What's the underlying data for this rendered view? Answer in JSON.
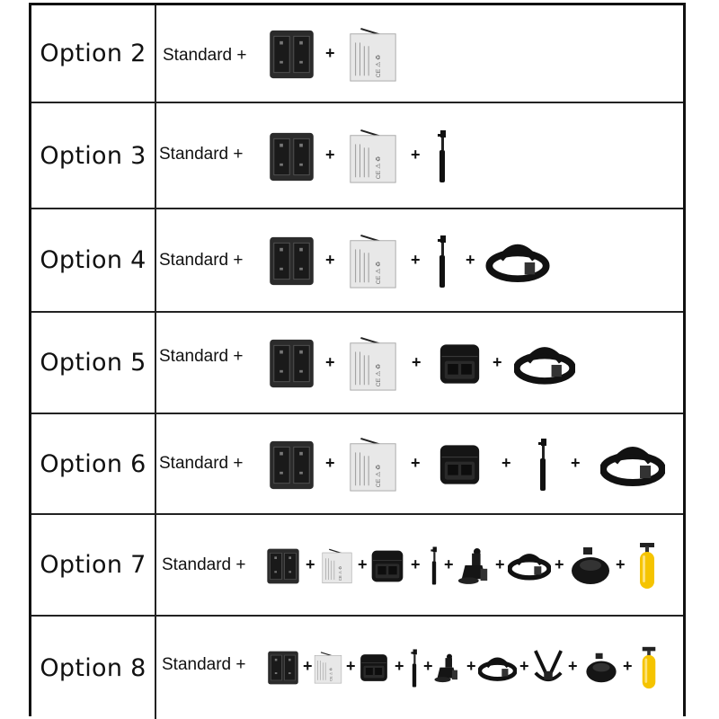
{
  "separator": "+",
  "rows": [
    {
      "label": "Option 2",
      "standard": "Standard +",
      "items": [
        "charger-icon",
        "battery-icon"
      ]
    },
    {
      "label": "Option 3",
      "standard": "Standard +",
      "items": [
        "charger-icon",
        "battery-icon",
        "monopod-icon"
      ]
    },
    {
      "label": "Option 4",
      "standard": "Standard +",
      "items": [
        "charger-icon",
        "battery-icon",
        "monopod-icon",
        "head-strap-icon"
      ]
    },
    {
      "label": "Option 5",
      "standard": "Standard +",
      "items": [
        "charger-icon",
        "battery-icon",
        "carry-case-icon",
        "head-strap-icon"
      ]
    },
    {
      "label": "Option 6",
      "standard": "Standard +",
      "items": [
        "charger-icon",
        "battery-icon",
        "carry-case-icon",
        "monopod-icon",
        "head-strap-icon"
      ]
    },
    {
      "label": "Option 7",
      "standard": "Standard +",
      "items": [
        "charger-icon",
        "battery-icon",
        "carry-case-icon",
        "monopod-icon",
        "suction-mount-icon",
        "head-strap-icon",
        "wrist-strap-icon",
        "floating-grip-icon"
      ]
    },
    {
      "label": "Option 8",
      "standard": "Standard +",
      "items": [
        "charger-icon",
        "battery-icon",
        "carry-case-icon",
        "monopod-icon",
        "suction-mount-icon",
        "head-strap-icon",
        "chest-strap-icon",
        "wrist-strap-icon",
        "floating-grip-icon"
      ]
    }
  ],
  "colors": {
    "border": "#111111",
    "charger": "#2b2b2b",
    "battery": "#e8e8e8",
    "floater": "#f5c400"
  }
}
